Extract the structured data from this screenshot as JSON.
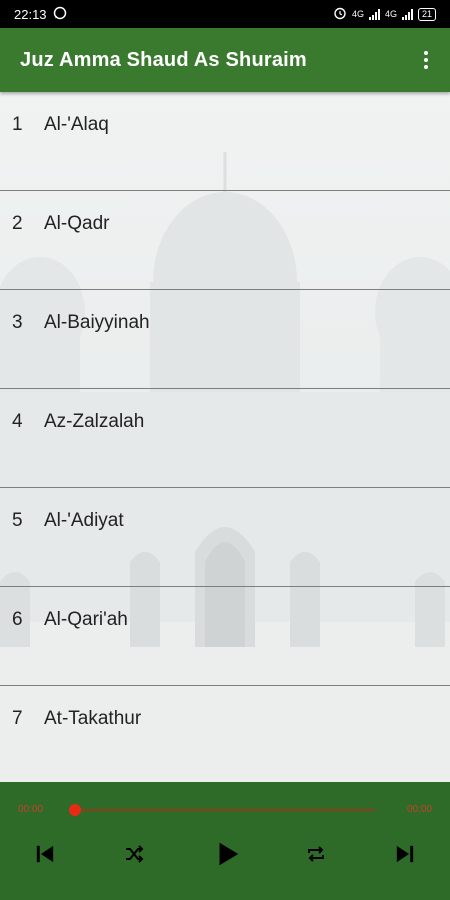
{
  "status_bar": {
    "time": "22:13",
    "battery": "21",
    "network_labels": [
      "4G",
      "4G"
    ]
  },
  "app_bar": {
    "title": "Juz Amma Shaud As Shuraim",
    "menu_icon": "more-vert-icon"
  },
  "surahs": [
    {
      "number": "1",
      "name": "Al-'Alaq"
    },
    {
      "number": "2",
      "name": "Al-Qadr"
    },
    {
      "number": "3",
      "name": "Al-Baiyyinah"
    },
    {
      "number": "4",
      "name": "Az-Zalzalah"
    },
    {
      "number": "5",
      "name": "Al-'Adiyat"
    },
    {
      "number": "6",
      "name": "Al-Qari'ah"
    },
    {
      "number": "7",
      "name": "At-Takathur"
    }
  ],
  "player": {
    "current_time": "00:00",
    "total_time": "00:00",
    "progress": 0,
    "controls": [
      "skip-previous-icon",
      "shuffle-icon",
      "play-icon",
      "repeat-icon",
      "skip-next-icon"
    ]
  },
  "colors": {
    "app_bar": "#3a7a2f",
    "player_bar": "#2e6a28",
    "seek_thumb": "#e82a14"
  }
}
